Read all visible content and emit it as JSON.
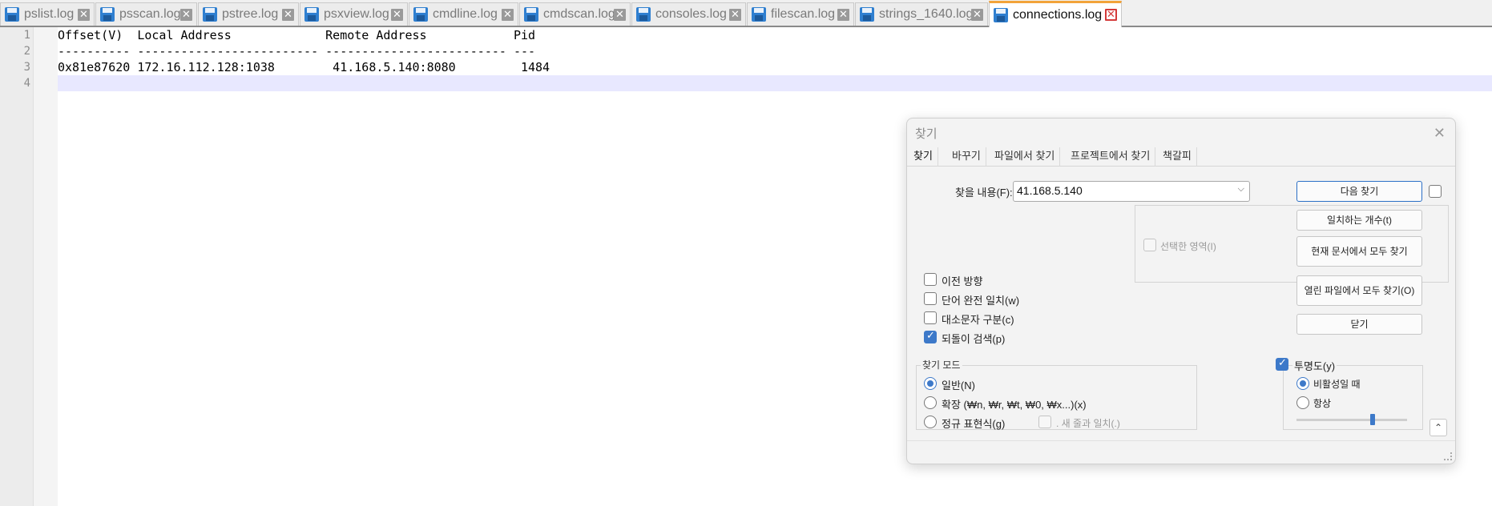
{
  "tabs": [
    {
      "label": "pslist.log",
      "active": false
    },
    {
      "label": "psscan.log",
      "active": false
    },
    {
      "label": "pstree.log",
      "active": false
    },
    {
      "label": "psxview.log",
      "active": false
    },
    {
      "label": "cmdline.log",
      "active": false
    },
    {
      "label": "cmdscan.log",
      "active": false
    },
    {
      "label": "consoles.log",
      "active": false
    },
    {
      "label": "filescan.log",
      "active": false
    },
    {
      "label": "strings_1640.log",
      "active": false
    },
    {
      "label": "connections.log",
      "active": true
    }
  ],
  "editor": {
    "lines": [
      {
        "no": "1",
        "text": "Offset(V)  Local Address             Remote Address            Pid"
      },
      {
        "no": "2",
        "text": "---------- ------------------------- ------------------------- ---"
      },
      {
        "no": "3",
        "text": "0x81e87620 172.16.112.128:1038        41.168.5.140:8080         1484"
      },
      {
        "no": "4",
        "text": ""
      }
    ]
  },
  "find_dialog": {
    "title": "찾기",
    "tabs": [
      "찾기",
      "바꾸기",
      "파일에서 찾기",
      "프로젝트에서 찾기",
      "책갈피"
    ],
    "find_label": "찾을 내용(F):",
    "find_value": "41.168.5.140",
    "buttons": {
      "find_next": "다음 찾기",
      "count": "일치하는 개수(t)",
      "find_all_current": "현재 문서에서 모두 찾기",
      "find_all_open": "열린 파일에서 모두 찾기(O)",
      "close": "닫기"
    },
    "in_selection": "선택한 영역(I)",
    "options": {
      "backward": "이전 방향",
      "whole_word": "단어 완전 일치(w)",
      "match_case": "대소문자 구분(c)",
      "wrap_around": "되돌이 검색(p)"
    },
    "search_mode": {
      "title": "찾기 모드",
      "normal": "일반(N)",
      "extended": "확장 (₩n, ₩r, ₩t, ₩0, ₩x...)(x)",
      "regex": "정규 표현식(g)",
      "dot_newline": ". 새 줄과 일치(.)"
    },
    "transparency": {
      "label": "투명도(y)",
      "on_lose_focus": "비활성일 때",
      "always": "항상"
    }
  }
}
